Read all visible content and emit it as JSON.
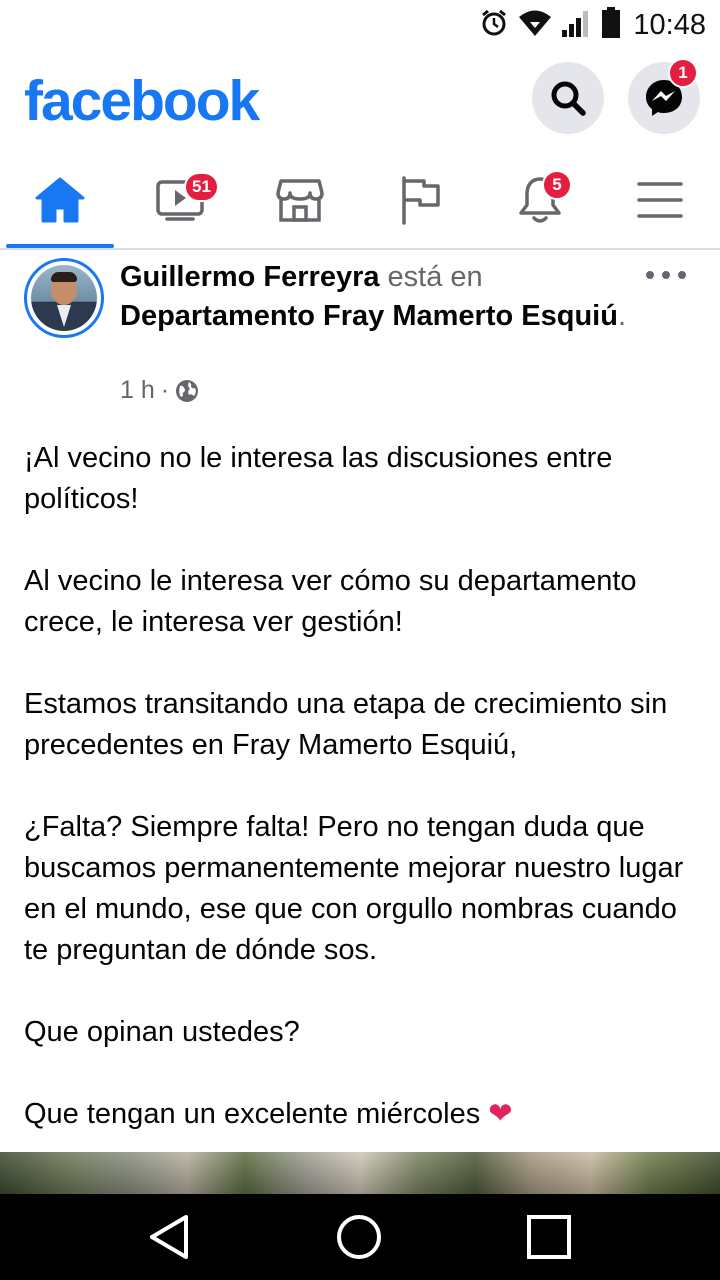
{
  "status_bar": {
    "time": "10:48",
    "icons": [
      "alarm-icon",
      "wifi-icon",
      "signal-icon",
      "battery-icon"
    ]
  },
  "header": {
    "logo": "facebook",
    "brand_color": "#1877f2",
    "messenger_badge": "1"
  },
  "tabs": [
    {
      "name": "home",
      "icon": "home-icon",
      "active": true,
      "badge": ""
    },
    {
      "name": "watch",
      "icon": "video-icon",
      "active": false,
      "badge": "51"
    },
    {
      "name": "marketplace",
      "icon": "store-icon",
      "active": false,
      "badge": ""
    },
    {
      "name": "pages",
      "icon": "flag-icon",
      "active": false,
      "badge": ""
    },
    {
      "name": "notifications",
      "icon": "bell-icon",
      "active": false,
      "badge": "5"
    },
    {
      "name": "menu",
      "icon": "menu-icon",
      "active": false,
      "badge": ""
    }
  ],
  "post": {
    "author": "Guillermo Ferreyra",
    "connector": " está en ",
    "location": "Departamento Fray Mamerto Esquiú",
    "period": ".",
    "time": "1 h",
    "separator": "·",
    "audience_icon": "globe-icon",
    "paragraphs": [
      "¡Al vecino no le interesa las discusiones entre políticos!",
      "Al vecino le interesa ver cómo su departamento crece, le interesa ver gestión!",
      "Estamos transitando una etapa de crecimiento sin precedentes en Fray Mamerto Esquiú,",
      "¿Falta? Siempre falta! Pero no tengan duda que buscamos permanentemente mejorar nuestro lugar en el mundo, ese que con orgullo nombras cuando te preguntan de dónde sos.",
      "Que opinan ustedes?"
    ],
    "last_line": "Que tengan un excelente miércoles",
    "last_emoji": "❤"
  },
  "navbar": {
    "buttons": [
      "back-icon",
      "home-circle-icon",
      "recents-icon"
    ]
  }
}
